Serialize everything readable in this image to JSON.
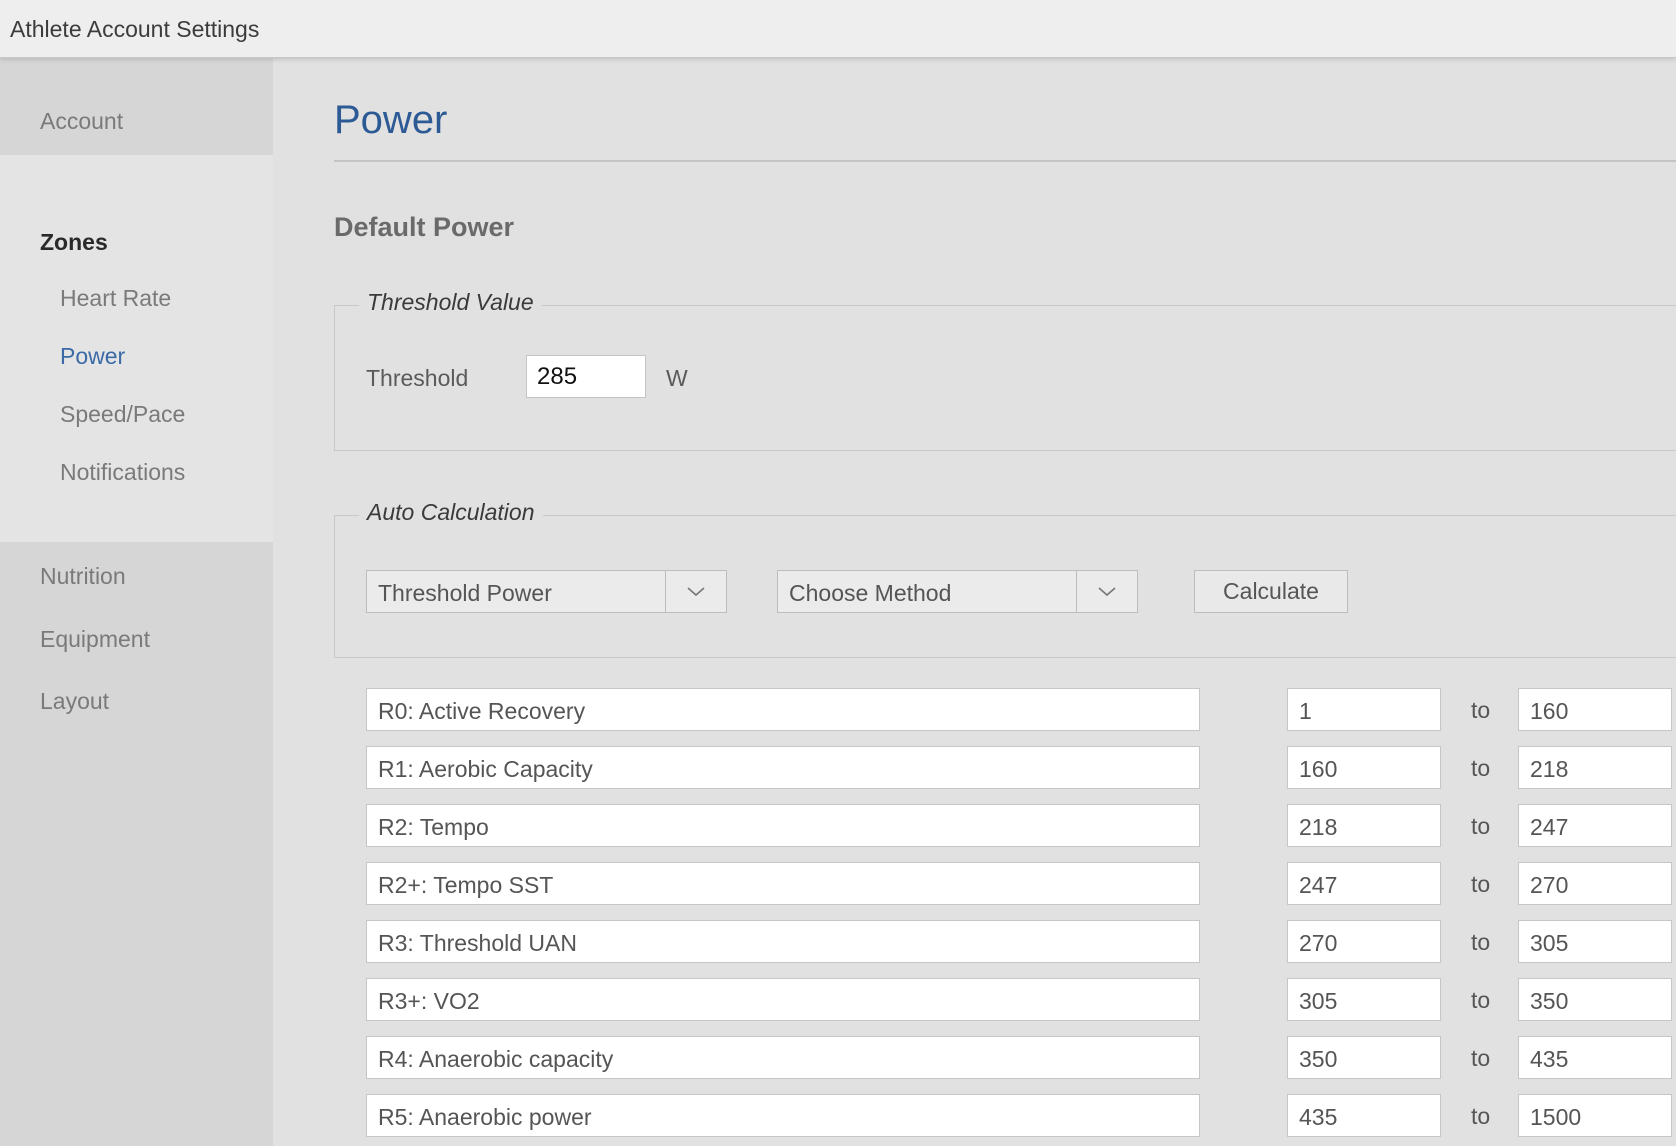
{
  "window": {
    "title": "Athlete Account Settings"
  },
  "sidebar": {
    "account": "Account",
    "zones": "Zones",
    "sub_items": [
      "Heart Rate",
      "Power",
      "Speed/Pace",
      "Notifications"
    ],
    "active_sub_item": "Power",
    "nutrition": "Nutrition",
    "equipment": "Equipment",
    "layout": "Layout"
  },
  "main": {
    "title": "Power",
    "section_title": "Default Power",
    "threshold": {
      "legend": "Threshold Value",
      "label": "Threshold",
      "value": "285",
      "unit": "W"
    },
    "auto": {
      "legend": "Auto Calculation",
      "select_1": "Threshold Power",
      "select_2": "Choose Method",
      "calculate_label": "Calculate"
    },
    "to_label": "to",
    "zones": [
      {
        "name": "R0: Active Recovery",
        "min": "1",
        "max": "160"
      },
      {
        "name": "R1: Aerobic Capacity",
        "min": "160",
        "max": "218"
      },
      {
        "name": "R2: Tempo",
        "min": "218",
        "max": "247"
      },
      {
        "name": "R2+: Tempo SST",
        "min": "247",
        "max": "270"
      },
      {
        "name": "R3: Threshold UAN",
        "min": "270",
        "max": "305"
      },
      {
        "name": "R3+: VO2",
        "min": "305",
        "max": "350"
      },
      {
        "name": "R4: Anaerobic capacity",
        "min": "350",
        "max": "435"
      },
      {
        "name": "R5: Anaerobic power",
        "min": "435",
        "max": "1500"
      }
    ]
  },
  "colors": {
    "accent": "#2c5a94",
    "active_link": "#3a6aa8",
    "sidebar_bg": "#d6d6d6",
    "subpanel_bg": "#e5e4e4",
    "main_bg": "#e2e1e1"
  },
  "icons": {
    "dropdown": "chevron-down-icon"
  }
}
